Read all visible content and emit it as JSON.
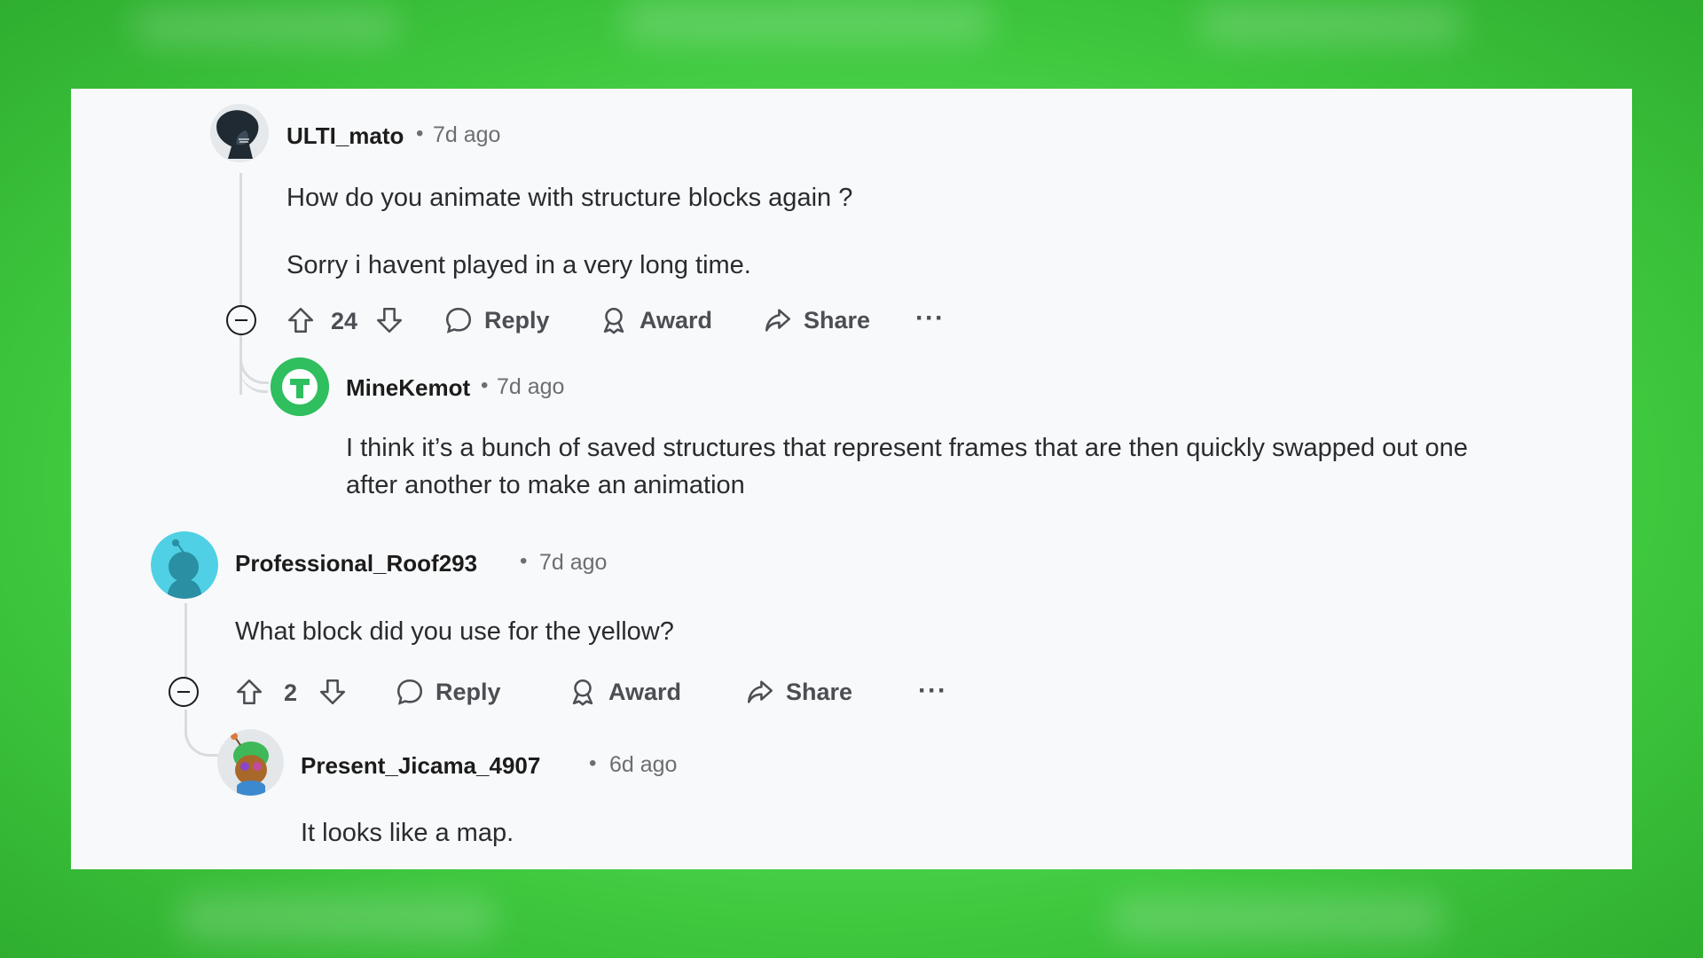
{
  "comments": [
    {
      "username": "ULTI_mato",
      "separator": "•",
      "time": "7d ago",
      "body": [
        "How do you animate with structure blocks again ?",
        "Sorry i havent played in a very long time."
      ],
      "score": "24",
      "actions": {
        "reply": "Reply",
        "award": "Award",
        "share": "Share",
        "more": "···"
      }
    },
    {
      "username": "MineKemot",
      "separator": "•",
      "time": "7d ago",
      "body": [
        "I think it’s a bunch of saved structures that represent frames that are then quickly swapped out one",
        "after another to make an animation"
      ]
    },
    {
      "username": "Professional_Roof293",
      "separator": "•",
      "time": "7d ago",
      "body": [
        "What block did you use for the yellow?"
      ],
      "score": "2",
      "actions": {
        "reply": "Reply",
        "award": "Award",
        "share": "Share",
        "more": "···"
      }
    },
    {
      "username": "Present_Jicama_4907",
      "separator": "•",
      "time": "6d ago",
      "body": [
        "It looks like a map."
      ]
    }
  ],
  "colors": {
    "background": "#5fdc5f",
    "card": "#f8f9fa",
    "text": "#1c1c1c",
    "muted": "#6b6e72",
    "thread": "#d9dcdf"
  },
  "icons": [
    "alien-avatar-icon",
    "t-avatar-icon",
    "snoo-avatar-icon",
    "character-avatar-icon",
    "upvote-icon",
    "downvote-icon",
    "comment-icon",
    "award-icon",
    "share-icon",
    "collapse-icon"
  ]
}
